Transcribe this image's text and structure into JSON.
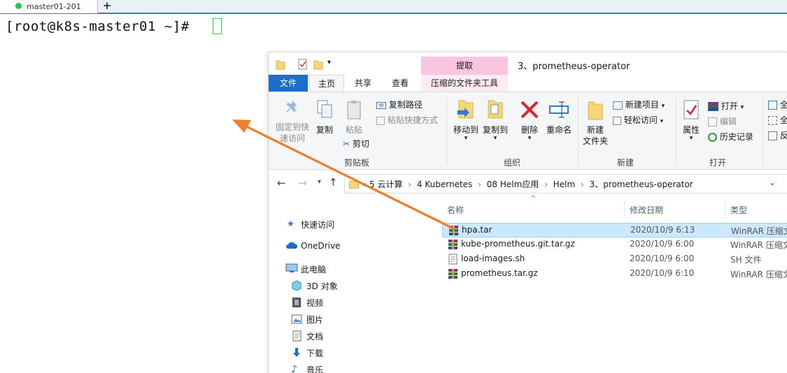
{
  "terminal": {
    "tab_label": "master01-201",
    "new_tab": "+",
    "prompt": "[root@k8s-master01 ~]#"
  },
  "explorer": {
    "title": "3、prometheus-operator",
    "extract_tab": "提取",
    "tabs": {
      "file": "文件",
      "home": "主页",
      "share": "共享",
      "view": "查看",
      "tools": "压缩的文件夹工具"
    },
    "ribbon": {
      "pin_l1": "固定到快",
      "pin_l2": "速访问",
      "copy": "复制",
      "paste": "粘贴",
      "copy_path": "复制路径",
      "paste_shortcut": "粘贴快捷方式",
      "cut": "剪切",
      "clipboard_group": "剪贴板",
      "move_to": "移动到",
      "copy_to": "复制到",
      "delete": "删除",
      "rename": "重命名",
      "organize_group": "组织",
      "new_folder_l1": "新建",
      "new_folder_l2": "文件夹",
      "new_item": "新建项目",
      "easy_access": "轻松访问",
      "new_group": "新建",
      "properties": "属性",
      "open": "打开",
      "edit": "编辑",
      "history": "历史记录",
      "open_group": "打开",
      "sel_all_partial": "全",
      "sel_none_partial": "全",
      "invert_partial": "反"
    },
    "breadcrumb": [
      "5 云计算",
      "4 Kubernetes",
      "08 Helm应用",
      "Helm",
      "3、prometheus-operator"
    ],
    "breadcrumb_sep": "›",
    "nav": {
      "quick_access": "快速访问",
      "onedrive": "OneDrive",
      "this_pc": "此电脑",
      "objects3d": "3D 对象",
      "videos": "视频",
      "pictures": "图片",
      "documents": "文档",
      "downloads": "下载",
      "music": "音乐"
    },
    "columns": {
      "name": "名称",
      "date": "修改日期",
      "type": "类型"
    },
    "files": [
      {
        "name": "hpa.tar",
        "date": "2020/10/9 6:13",
        "type": "WinRAR 压缩文",
        "icon": "winrar-icon",
        "selected": true
      },
      {
        "name": "kube-prometheus.git.tar.gz",
        "date": "2020/10/9 6:00",
        "type": "WinRAR 压缩文",
        "icon": "winrar-icon",
        "selected": false
      },
      {
        "name": "load-images.sh",
        "date": "2020/10/9 6:00",
        "type": "SH 文件",
        "icon": "script-file-icon",
        "selected": false
      },
      {
        "name": "prometheus.tar.gz",
        "date": "2020/10/9 6:10",
        "type": "WinRAR 压缩文",
        "icon": "winrar-icon",
        "selected": false
      }
    ]
  },
  "colors": {
    "accent_blue": "#1a6fc9",
    "extract_pink": "#f9c4dd",
    "selection": "#cce8ff",
    "annotation_arrow": "#f07d2c",
    "cursor_green": "#2ad34a"
  }
}
